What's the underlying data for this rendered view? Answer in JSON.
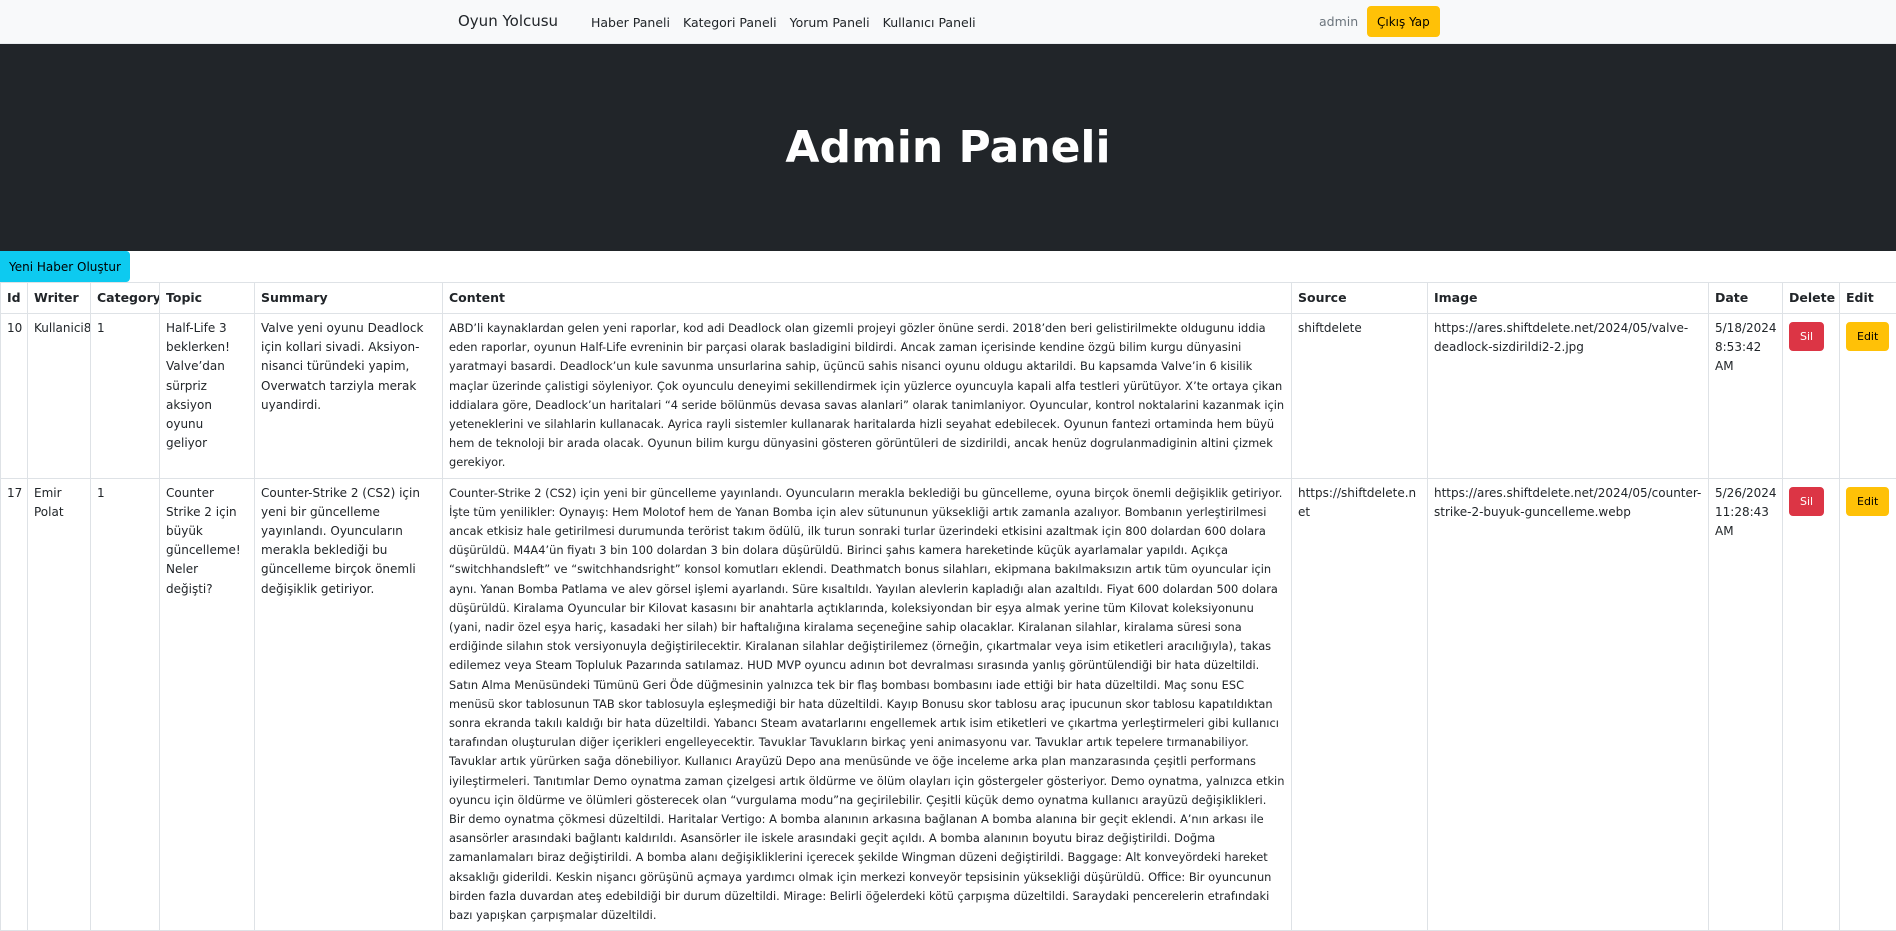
{
  "navbar": {
    "brand": "Oyun Yolcusu",
    "links": [
      "Haber Paneli",
      "Kategori Paneli",
      "Yorum Paneli",
      "Kullanıcı Paneli"
    ],
    "user": "admin",
    "logout_label": "Çıkış Yap"
  },
  "hero": {
    "title": "Admin Paneli"
  },
  "create_label": "Yeni Haber Oluştur",
  "table": {
    "headers": [
      "Id",
      "Writer",
      "Category",
      "Topic",
      "Summary",
      "Content",
      "Source",
      "Image",
      "Date",
      "Delete",
      "Edit"
    ],
    "rows": [
      {
        "id": "10",
        "writer": "Kullanici8",
        "category": "1",
        "topic": "Half-Life 3 beklerken! Valve’dan sürpriz aksiyon oyunu geliyor",
        "summary": "Valve yeni oyunu Deadlock için kollari sivadi. Aksiyon-nisanci türündeki yapim, Overwatch tarziyla merak uyandirdi.",
        "content": "ABD’li kaynaklardan gelen yeni raporlar, kod adi Deadlock olan gizemli projeyi gözler önüne serdi. 2018’den beri gelistirilmekte oldugunu iddia eden raporlar, oyunun Half-Life evreninin bir parçasi olarak basladigini bildirdi. Ancak zaman içerisinde kendine özgü bilim kurgu dünyasini yaratmayi basardi. Deadlock’un kule savunma unsurlarina sahip, üçüncü sahis nisanci oyunu oldugu aktarildi. Bu kapsamda Valve’in 6 kisilik maçlar üzerinde çalistigi söyleniyor. Çok oyunculu deneyimi sekillendirmek için yüzlerce oyuncuyla kapali alfa testleri yürütüyor. X’te ortaya çikan iddialara göre, Deadlock’un haritalari “4 seride bölünmüs devasa savas alanlari” olarak tanimlaniyor. Oyuncular, kontrol noktalarini kazanmak için yeteneklerini ve silahlarin kullanacak. Ayrica rayli sistemler kullanarak haritalarda hizli seyahat edebilecek. Oyunun fantezi ortaminda hem büyü hem de teknoloji bir arada olacak. Oyunun bilim kurgu dünyasini gösteren görüntüleri de sizdirildi, ancak henüz dogrulanmadiginin altini çizmek gerekiyor.",
        "source": "shiftdelete",
        "image": "https://ares.shiftdelete.net/2024/05/valve-deadlock-sizdirildi2-2.jpg",
        "date": "5/18/2024 8:53:42 AM",
        "delete_label": "Sil",
        "edit_label": "Edit"
      },
      {
        "id": "17",
        "writer": "Emir Polat",
        "category": "1",
        "topic": "Counter Strike 2 için büyük güncelleme! Neler değişti?",
        "summary": "Counter-Strike 2 (CS2) için yeni bir güncelleme yayınlandı. Oyuncuların merakla beklediği bu güncelleme birçok önemli değişiklik getiriyor.",
        "content": "Counter-Strike 2 (CS2) için yeni bir güncelleme yayınlandı. Oyuncuların merakla beklediği bu güncelleme, oyuna birçok önemli değişiklik getiriyor. İşte tüm yenilikler: Oynayış: Hem Molotof hem de Yanan Bomba için alev sütununun yüksekliği artık zamanla azalıyor. Bombanın yerleştirilmesi ancak etkisiz hale getirilmesi durumunda terörist takım ödülü, ilk turun sonraki turlar üzerindeki etkisini azaltmak için 800 dolardan 600 dolara düşürüldü. M4A4’ün fiyatı 3 bin 100 dolardan 3 bin dolara düşürüldü. Birinci şahıs kamera hareketinde küçük ayarlamalar yapıldı. Açıkça “switchhandsleft” ve “switchhandsright” konsol komutları eklendi. Deathmatch bonus silahları, ekipmana bakılmaksızın artık tüm oyuncular için aynı. Yanan Bomba Patlama ve alev görsel işlemi ayarlandı. Süre kısaltıldı. Yayılan alevlerin kapladığı alan azaltıldı. Fiyat 600 dolardan 500 dolara düşürüldü. Kiralama Oyuncular bir Kilovat kasasını bir anahtarla açtıklarında, koleksiyondan bir eşya almak yerine tüm Kilovat koleksiyonunu (yani, nadir özel eşya hariç, kasadaki her silah) bir haftalığına kiralama seçeneğine sahip olacaklar. Kiralanan silahlar, kiralama süresi sona erdiğinde silahın stok versiyonuyla değiştirilecektir. Kiralanan silahlar değiştirilemez (örneğin, çıkartmalar veya isim etiketleri aracılığıyla), takas edilemez veya Steam Topluluk Pazarında satılamaz. HUD MVP oyuncu adının bot devralması sırasında yanlış görüntülendiği bir hata düzeltildi. Satın Alma Menüsündeki Tümünü Geri Öde düğmesinin yalnızca tek bir flaş bombası bombasını iade ettiği bir hata düzeltildi. Maç sonu ESC menüsü skor tablosunun TAB skor tablosuyla eşleşmediği bir hata düzeltildi. Kayıp Bonusu skor tablosu araç ipucunun skor tablosu kapatıldıktan sonra ekranda takılı kaldığı bir hata düzeltildi. Yabancı Steam avatarlarını engellemek artık isim etiketleri ve çıkartma yerleştirmeleri gibi kullanıcı tarafından oluşturulan diğer içerikleri engelleyecektir. Tavuklar Tavukların birkaç yeni animasyonu var. Tavuklar artık tepelere tırmanabiliyor. Tavuklar artık yürürken sağa dönebiliyor. Kullanıcı Arayüzü Depo ana menüsünde ve öğe inceleme arka plan manzarasında çeşitli performans iyileştirmeleri. Tanıtımlar Demo oynatma zaman çizelgesi artık öldürme ve ölüm olayları için göstergeler gösteriyor. Demo oynatma, yalnızca etkin oyuncu için öldürme ve ölümleri gösterecek olan “vurgulama modu”na geçirilebilir. Çeşitli küçük demo oynatma kullanıcı arayüzü değişiklikleri. Bir demo oynatma çökmesi düzeltildi. Haritalar Vertigo: A bomba alanının arkasına bağlanan A bomba alanına bir geçit eklendi. A’nın arkası ile asansörler arasındaki bağlantı kaldırıldı. Asansörler ile iskele arasındaki geçit açıldı. A bomba alanının boyutu biraz değiştirildi. Doğma zamanlamaları biraz değiştirildi. A bomba alanı değişikliklerini içerecek şekilde Wingman düzeni değiştirildi. Baggage: Alt konveyördeki hareket aksaklığı giderildi. Keskin nişancı görüşünü açmaya yardımcı olmak için merkezi konveyör tepsisinin yüksekliği düşürüldü. Office: Bir oyuncunun birden fazla duvardan ateş edebildiği bir durum düzeltildi. Mirage: Belirli öğelerdeki kötü çarpışma düzeltildi. Saraydaki pencerelerin etrafındaki bazı yapışkan çarpışmalar düzeltildi.",
        "source": "https://shiftdelete.net",
        "image": "https://ares.shiftdelete.net/2024/05/counter-strike-2-buyuk-guncelleme.webp",
        "date": "5/26/2024 11:28:43 AM",
        "delete_label": "Sil",
        "edit_label": "Edit"
      }
    ]
  },
  "colors": {
    "navbar_bg": "#f8f9fa",
    "hero_bg": "#212529",
    "warning": "#ffc107",
    "info": "#0dcaf0",
    "danger": "#dc3545"
  }
}
